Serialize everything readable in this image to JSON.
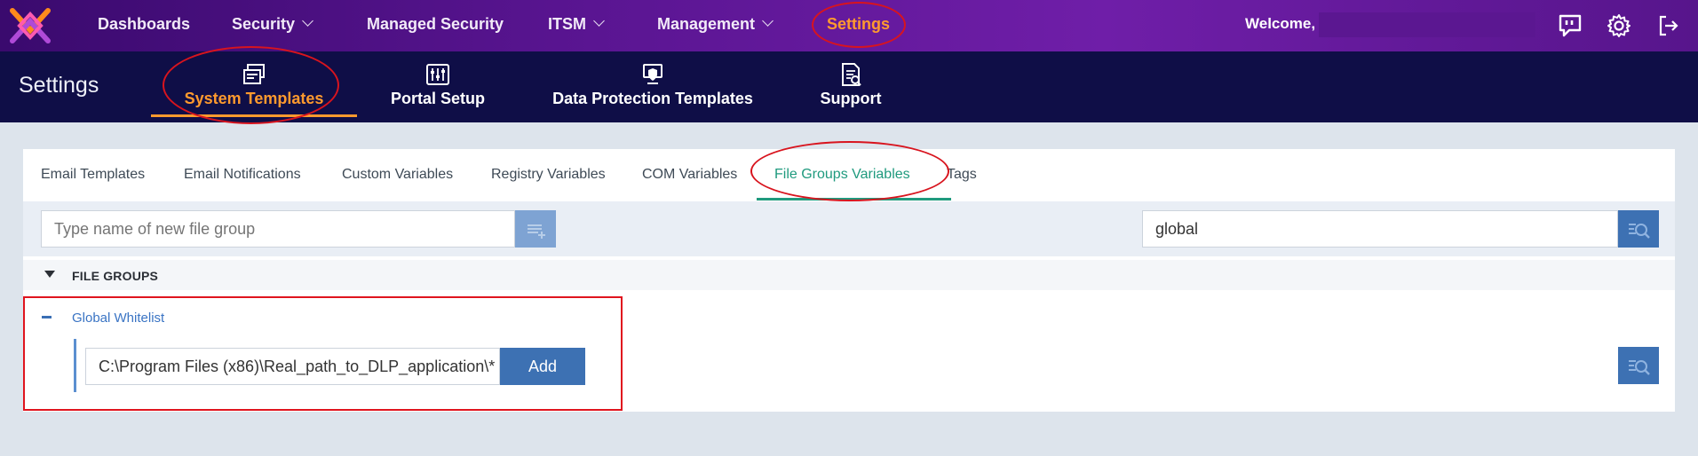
{
  "topnav": {
    "items": [
      {
        "label": "Dashboards",
        "has_menu": false
      },
      {
        "label": "Security",
        "has_menu": true
      },
      {
        "label": "Managed Security",
        "has_menu": false
      },
      {
        "label": "ITSM",
        "has_menu": true
      },
      {
        "label": "Management",
        "has_menu": true
      },
      {
        "label": "Settings",
        "has_menu": false,
        "active": true
      }
    ],
    "welcome": "Welcome,",
    "icons": [
      "feedback-icon",
      "gear-icon",
      "logout-icon"
    ]
  },
  "subheader": {
    "title": "Settings",
    "tabs": [
      {
        "label": "System Templates",
        "icon": "templates-icon",
        "active": true
      },
      {
        "label": "Portal Setup",
        "icon": "sliders-icon"
      },
      {
        "label": "Data Protection Templates",
        "icon": "shield-screen-icon"
      },
      {
        "label": "Support",
        "icon": "support-doc-icon"
      }
    ]
  },
  "tabs": [
    {
      "label": "Email Templates"
    },
    {
      "label": "Email Notifications"
    },
    {
      "label": "Custom Variables"
    },
    {
      "label": "Registry Variables"
    },
    {
      "label": "COM Variables"
    },
    {
      "label": "File Groups Variables",
      "active": true
    },
    {
      "label": "Tags"
    }
  ],
  "toolbar": {
    "new_group_placeholder": "Type name of new file group",
    "search_value": "global"
  },
  "file_groups": {
    "header": "FILE GROUPS",
    "groups": [
      {
        "name": "Global Whitelist",
        "path_value": "C:\\Program Files (x86)\\Real_path_to_DLP_application\\*",
        "add_label": "Add"
      }
    ]
  },
  "colors": {
    "accent_orange": "#ff9a2e",
    "active_tab_green": "#1f9a7e",
    "button_blue": "#3d71b3",
    "annotation_red": "#d8141e"
  }
}
